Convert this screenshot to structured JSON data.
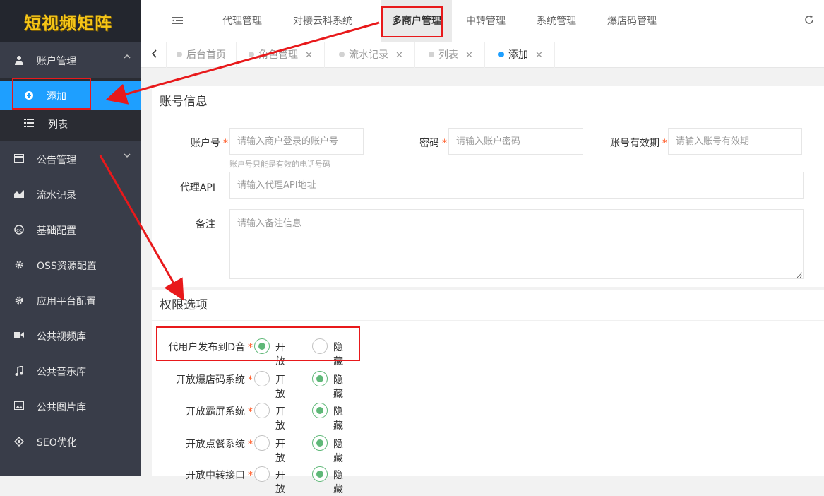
{
  "logo": "短视频矩阵",
  "sidebar": {
    "account": {
      "label": "账户管理",
      "icon": "user-icon"
    },
    "sub": [
      {
        "label": "添加",
        "icon": "plus-circle-icon"
      },
      {
        "label": "列表",
        "icon": "list-icon"
      }
    ],
    "items": [
      {
        "label": "公告管理",
        "icon": "card-icon"
      },
      {
        "label": "流水记录",
        "icon": "area-chart-icon"
      },
      {
        "label": "基础配置",
        "icon": "cc-icon"
      },
      {
        "label": "OSS资源配置",
        "icon": "gear-icon"
      },
      {
        "label": "应用平台配置",
        "icon": "gear-icon"
      },
      {
        "label": "公共视频库",
        "icon": "video-icon"
      },
      {
        "label": "公共音乐库",
        "icon": "music-icon"
      },
      {
        "label": "公共图片库",
        "icon": "image-icon"
      },
      {
        "label": "SEO优化",
        "icon": "network-icon"
      }
    ]
  },
  "topnav": [
    "代理管理",
    "对接云科系统",
    "多商户管理",
    "中转管理",
    "系统管理",
    "爆店码管理"
  ],
  "tabs": [
    "后台首页",
    "角色管理",
    "流水记录",
    "列表",
    "添加"
  ],
  "form": {
    "section1": "账号信息",
    "account_label": "账户号",
    "account_ph": "请输入商户登录的账户号",
    "account_hint": "账户号只能是有效的电话号码",
    "password_label": "密码",
    "password_ph": "请输入账户密码",
    "expire_label": "账号有效期",
    "expire_ph": "请输入账号有效期",
    "api_label": "代理API",
    "api_ph": "请输入代理API地址",
    "note_label": "备注",
    "note_ph": "请输入备注信息",
    "section2": "权限选项",
    "open": "开放",
    "hide": "隐藏",
    "perms": [
      {
        "label": "代用户发布到D音",
        "value": "开放"
      },
      {
        "label": "开放爆店码系统",
        "value": "隐藏"
      },
      {
        "label": "开放霸屏系统",
        "value": "隐藏"
      },
      {
        "label": "开放点餐系统",
        "value": "隐藏"
      },
      {
        "label": "开放中转接口",
        "value": "隐藏"
      }
    ]
  },
  "colors": {
    "accent": "#1e9fff",
    "sidebar": "#393d49",
    "radio_on": "#5fb878",
    "highlight": "#e8191b"
  }
}
